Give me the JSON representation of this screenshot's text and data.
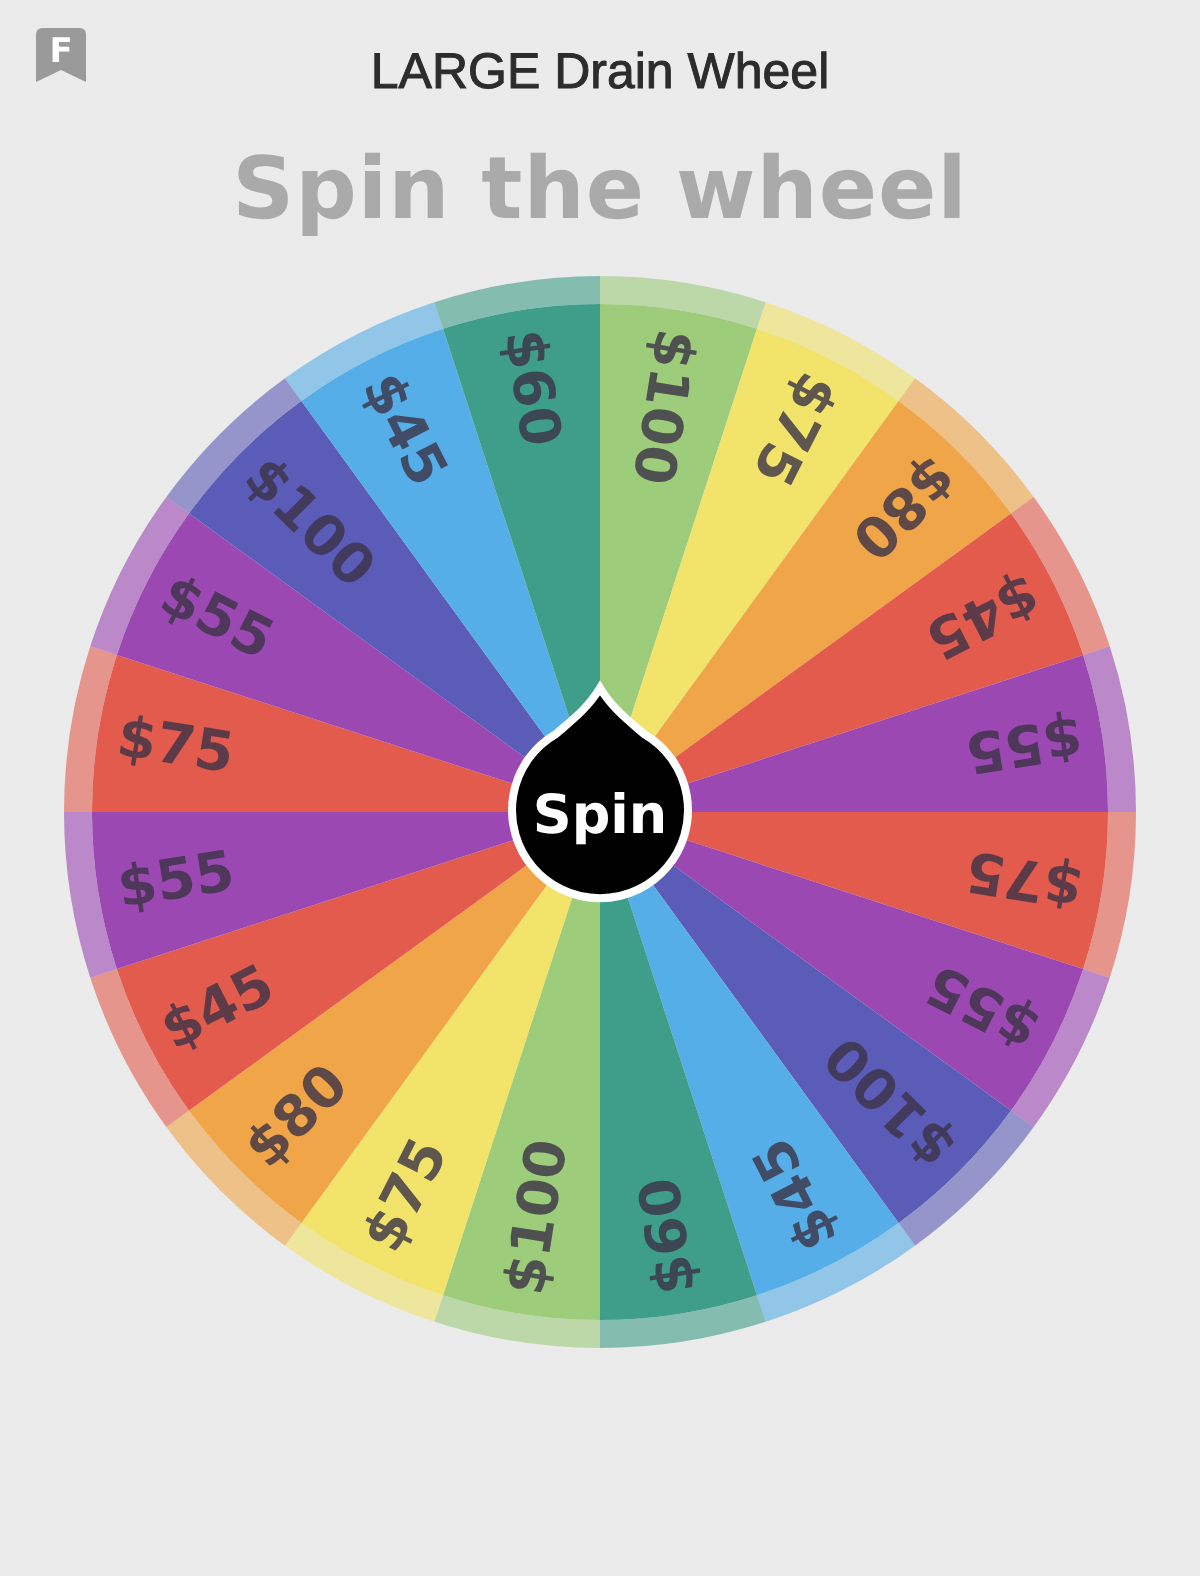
{
  "app_badge": "F",
  "title": "LARGE Drain Wheel",
  "subtitle": "Spin the wheel",
  "wheel": {
    "segments": [
      {
        "label": "$100",
        "color": "#9dcc7b"
      },
      {
        "label": "$75",
        "color": "#f2e36b"
      },
      {
        "label": "$80",
        "color": "#f0a548"
      },
      {
        "label": "$45",
        "color": "#e35b4d"
      },
      {
        "label": "$55",
        "color": "#9b48b3"
      },
      {
        "label": "$75",
        "color": "#e35b4d"
      },
      {
        "label": "$55",
        "color": "#9b48b3"
      },
      {
        "label": "$100",
        "color": "#5b5bb8"
      },
      {
        "label": "$45",
        "color": "#56aee8"
      },
      {
        "label": "$60",
        "color": "#3f9e89"
      },
      {
        "label": "$100",
        "color": "#9dcc7b"
      },
      {
        "label": "$75",
        "color": "#f2e36b"
      },
      {
        "label": "$80",
        "color": "#f0a548"
      },
      {
        "label": "$45",
        "color": "#e35b4d"
      },
      {
        "label": "$55",
        "color": "#9b48b3"
      },
      {
        "label": "$75",
        "color": "#e35b4d"
      },
      {
        "label": "$55",
        "color": "#9b48b3"
      },
      {
        "label": "$100",
        "color": "#5b5bb8"
      },
      {
        "label": "$45",
        "color": "#56aee8"
      },
      {
        "label": "$60",
        "color": "#3f9e89"
      }
    ],
    "button": "Spin"
  }
}
